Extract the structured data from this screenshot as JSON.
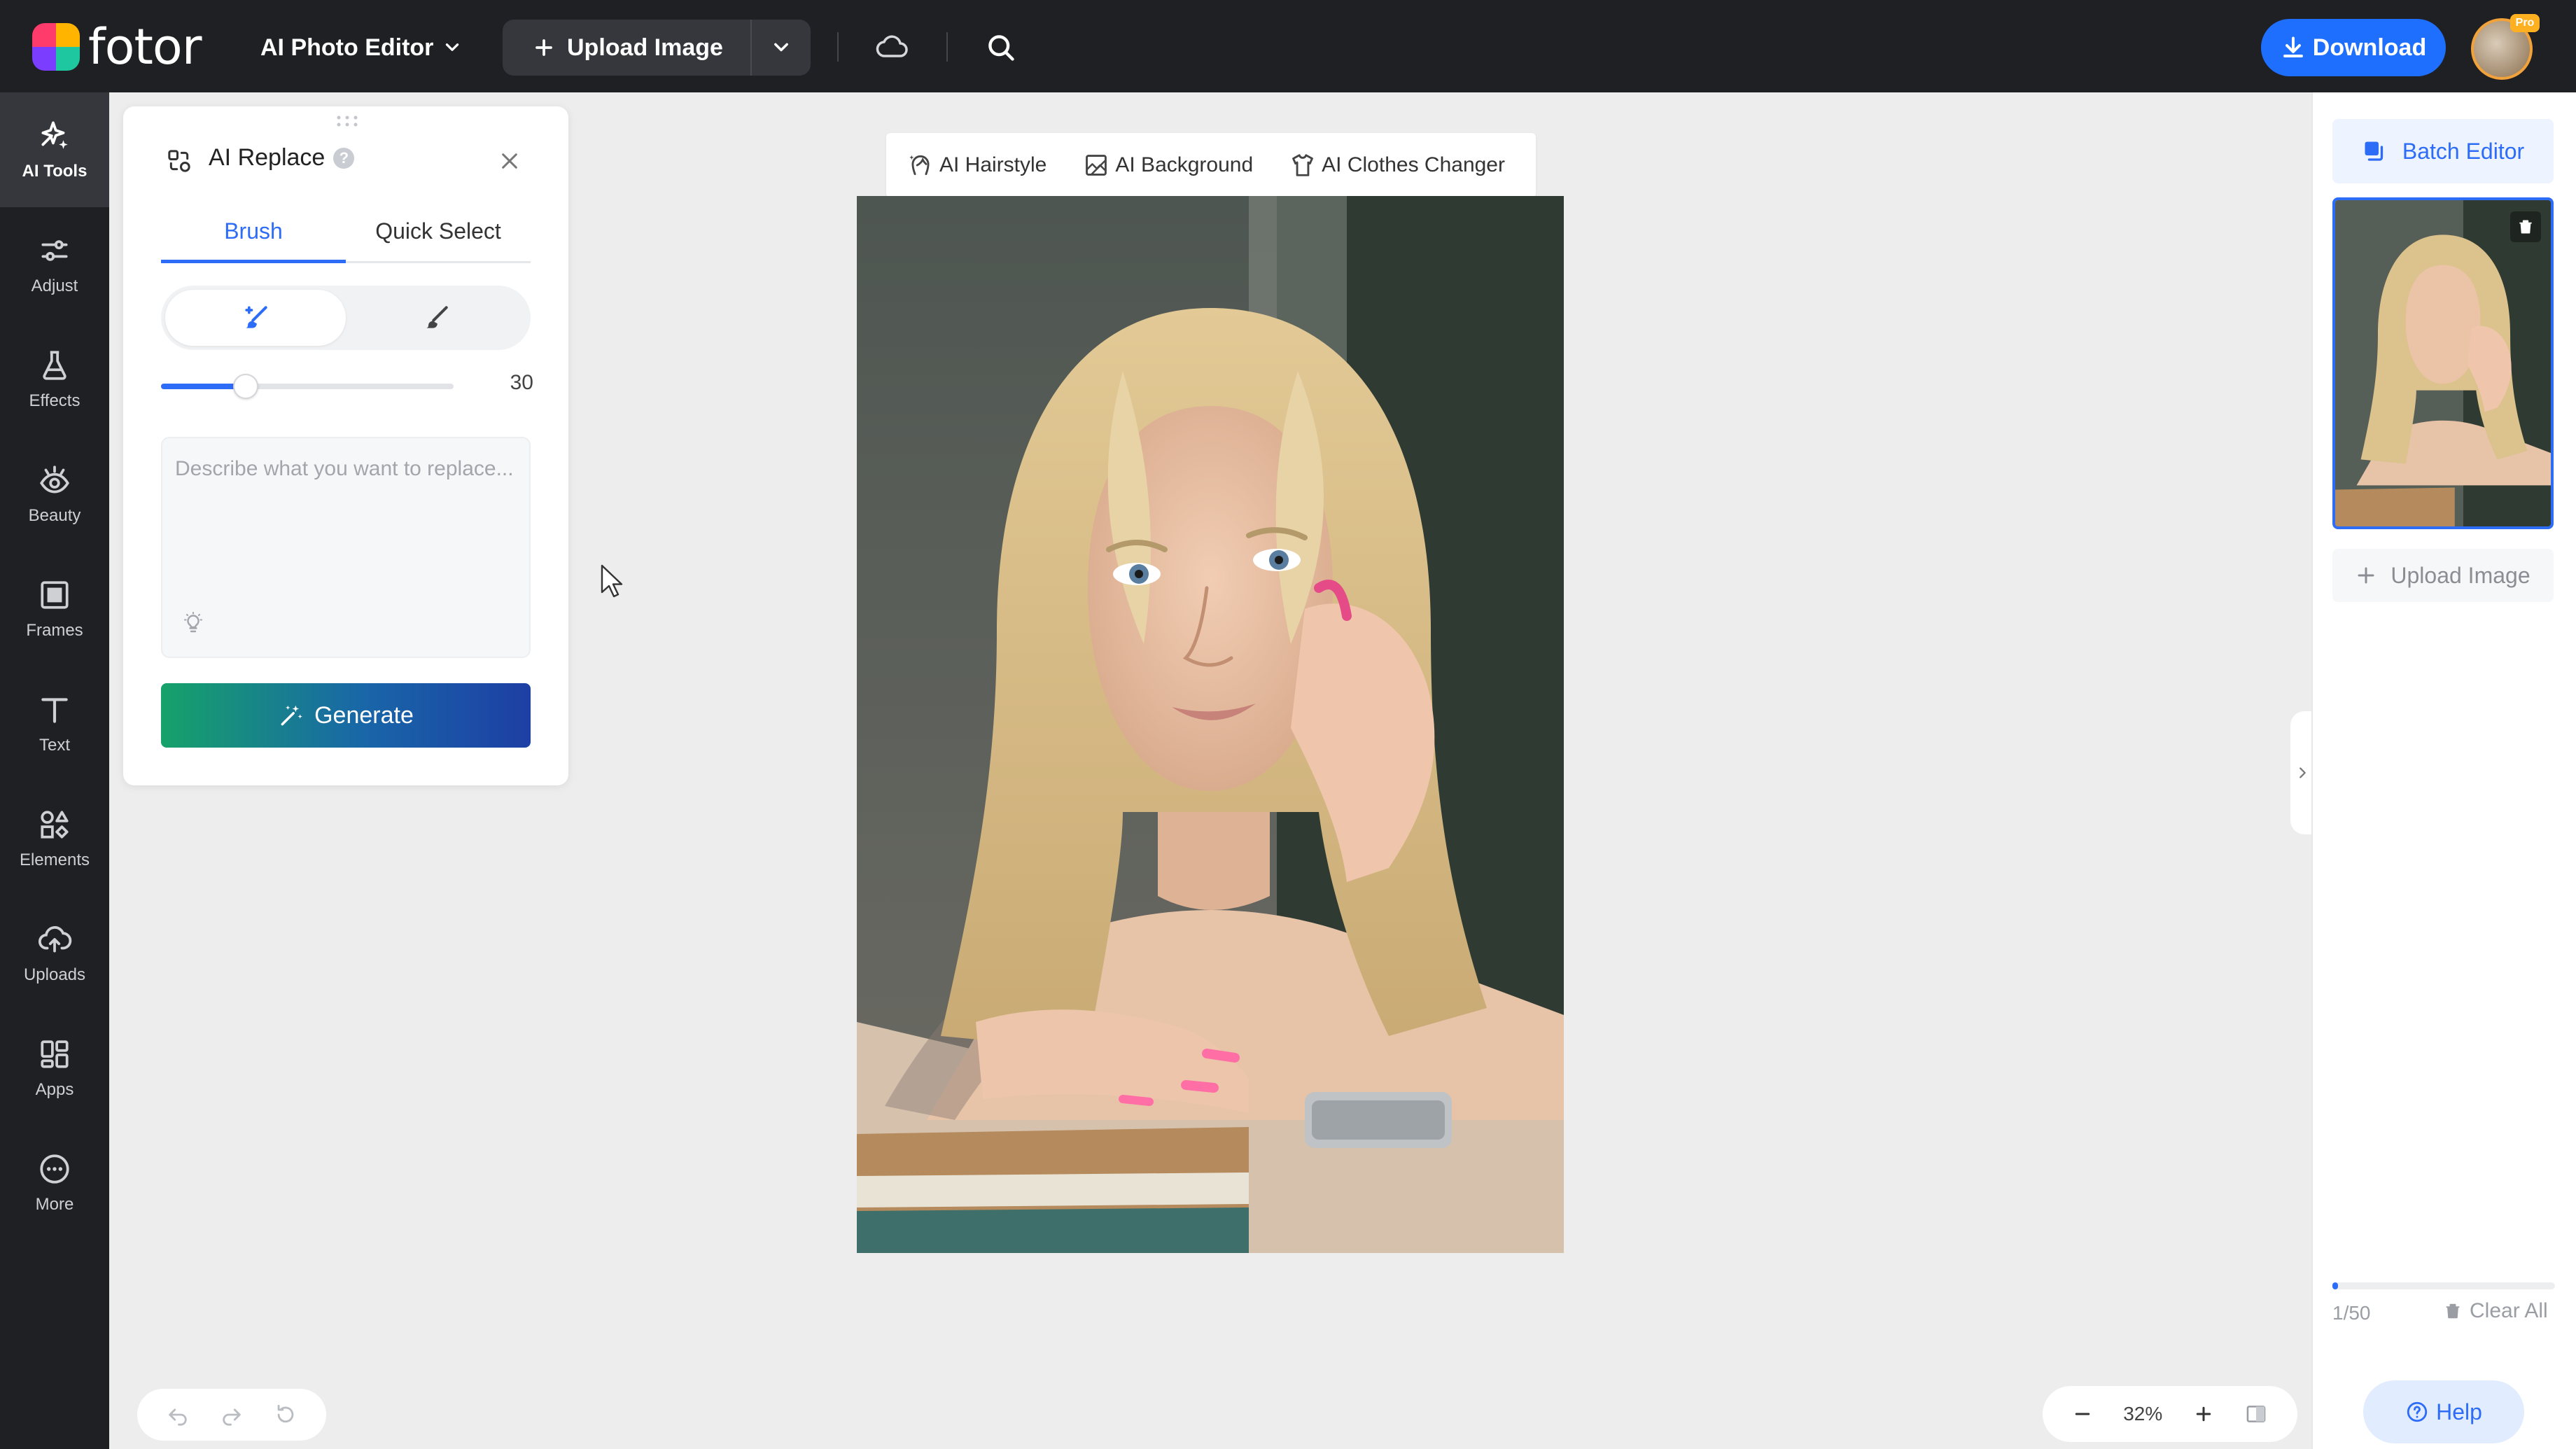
{
  "app": {
    "logo_text": "fotor",
    "mode_label": "AI Photo Editor",
    "upload_label": "Upload Image",
    "download_label": "Download",
    "pro_badge": "Pro",
    "accent_color": "#2d6cf6"
  },
  "sidebar": {
    "items": [
      {
        "label": "AI Tools",
        "icon": "sparkles-icon"
      },
      {
        "label": "Adjust",
        "icon": "sliders-icon"
      },
      {
        "label": "Effects",
        "icon": "flask-icon"
      },
      {
        "label": "Beauty",
        "icon": "eye-icon"
      },
      {
        "label": "Frames",
        "icon": "frame-icon"
      },
      {
        "label": "Text",
        "icon": "text-icon"
      },
      {
        "label": "Elements",
        "icon": "shapes-icon"
      },
      {
        "label": "Uploads",
        "icon": "cloud-upload-icon"
      },
      {
        "label": "Apps",
        "icon": "apps-icon"
      },
      {
        "label": "More",
        "icon": "more-icon"
      }
    ]
  },
  "panel": {
    "title": "AI Replace",
    "tabs": [
      {
        "label": "Brush",
        "active": true
      },
      {
        "label": "Quick Select",
        "active": false
      }
    ],
    "brush_mode": "add",
    "brush_size": "30",
    "brush_size_fraction": 0.29,
    "prompt_placeholder": "Describe what you want to replace...",
    "prompt_value": "",
    "generate_label": "Generate"
  },
  "feature_bar": {
    "items": [
      {
        "label": "AI Hairstyle",
        "icon": "hairstyle-icon"
      },
      {
        "label": "AI Background",
        "icon": "background-icon"
      },
      {
        "label": "AI Clothes Changer",
        "icon": "shirt-icon"
      }
    ]
  },
  "zoom": {
    "level": "32%"
  },
  "right_panel": {
    "batch_label": "Batch Editor",
    "upload_label": "Upload Image",
    "count": "1/50",
    "count_fraction": 0.02,
    "clear_label": "Clear All",
    "help_label": "Help"
  }
}
